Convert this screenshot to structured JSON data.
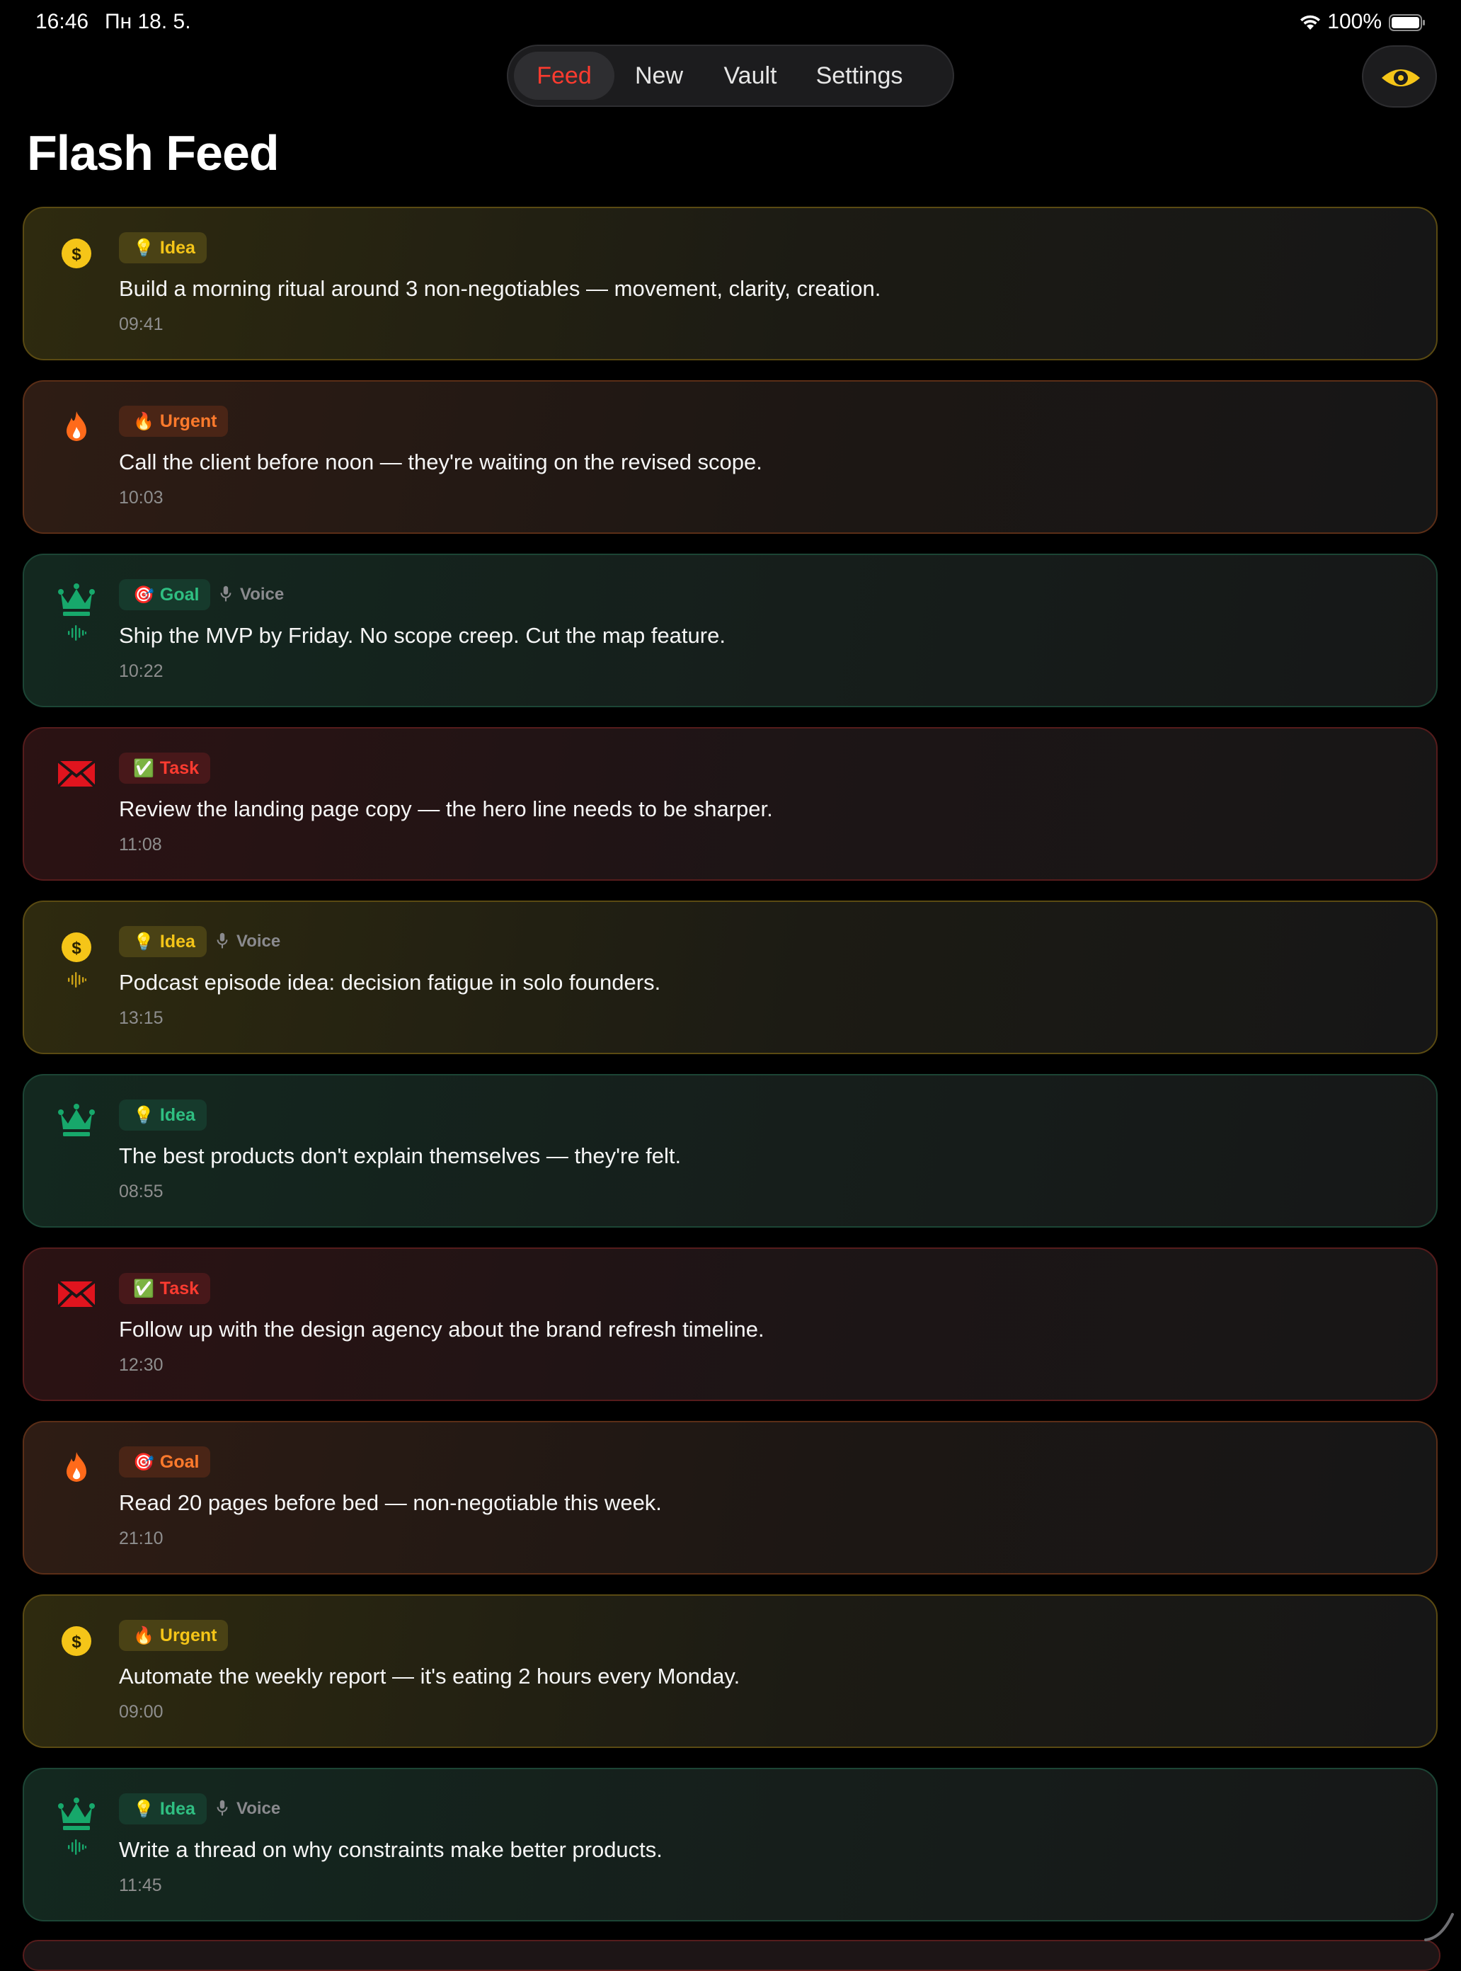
{
  "status": {
    "time": "16:46",
    "date": "Пн 18. 5.",
    "battery": "100%"
  },
  "nav": {
    "tabs": [
      {
        "label": "Feed",
        "active": true
      },
      {
        "label": "New"
      },
      {
        "label": "Vault"
      },
      {
        "label": "Settings"
      }
    ]
  },
  "page": {
    "title": "Flash Feed"
  },
  "feed": [
    {
      "theme": "gold",
      "icon": "dollar-icon",
      "tag_emoji": "💡",
      "tag": "Idea",
      "voice": false,
      "text": "Build a morning ritual around 3 non-negotiables — movement, clarity, creation.",
      "time": "09:41"
    },
    {
      "theme": "orange",
      "icon": "flame-icon",
      "tag_emoji": "🔥",
      "tag": "Urgent",
      "voice": false,
      "text": "Call the client before noon — they're waiting on the revised scope.",
      "time": "10:03"
    },
    {
      "theme": "green",
      "icon": "crown-icon",
      "tag_emoji": "🎯",
      "tag": "Goal",
      "voice": true,
      "voice_label": "Voice",
      "text": "Ship the MVP by Friday. No scope creep. Cut the map feature.",
      "time": "10:22"
    },
    {
      "theme": "red",
      "icon": "mail-icon",
      "tag_emoji": "✅",
      "tag": "Task",
      "voice": false,
      "text": "Review the landing page copy — the hero line needs to be sharper.",
      "time": "11:08"
    },
    {
      "theme": "gold",
      "icon": "dollar-icon",
      "tag_emoji": "💡",
      "tag": "Idea",
      "voice": true,
      "voice_label": "Voice",
      "text": "Podcast episode idea: decision fatigue in solo founders.",
      "time": "13:15"
    },
    {
      "theme": "green",
      "icon": "crown-icon",
      "tag_emoji": "💡",
      "tag": "Idea",
      "voice": false,
      "text": "The best products don't explain themselves — they're felt.",
      "time": "08:55"
    },
    {
      "theme": "red",
      "icon": "mail-icon",
      "tag_emoji": "✅",
      "tag": "Task",
      "voice": false,
      "text": "Follow up with the design agency about the brand refresh timeline.",
      "time": "12:30"
    },
    {
      "theme": "orange",
      "icon": "flame-icon",
      "tag_emoji": "🎯",
      "tag": "Goal",
      "voice": false,
      "text": "Read 20 pages before bed — non-negotiable this week.",
      "time": "21:10"
    },
    {
      "theme": "gold",
      "icon": "dollar-icon",
      "tag_emoji": "🔥",
      "tag": "Urgent",
      "voice": false,
      "text": "Automate the weekly report — it's eating 2 hours every Monday.",
      "time": "09:00"
    },
    {
      "theme": "green",
      "icon": "crown-icon",
      "tag_emoji": "💡",
      "tag": "Idea",
      "voice": true,
      "voice_label": "Voice",
      "text": "Write a thread on why constraints make better products.",
      "time": "11:45"
    }
  ],
  "colors": {
    "accent": "#ff3b2f",
    "gold": "#f5c518",
    "orange": "#ff6a1a",
    "green": "#17a86b",
    "red": "#e0141e",
    "eye": "#f5c518"
  }
}
